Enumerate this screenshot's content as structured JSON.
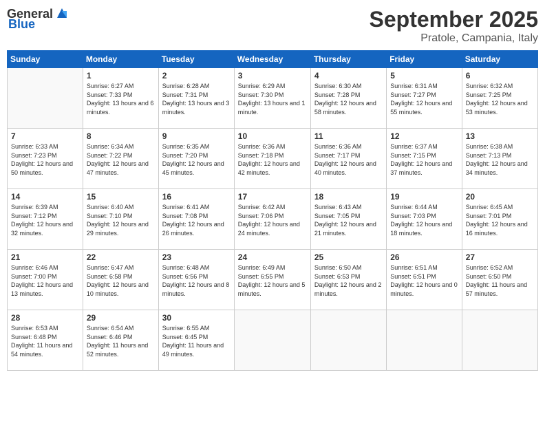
{
  "logo": {
    "text_general": "General",
    "text_blue": "Blue"
  },
  "header": {
    "month": "September 2025",
    "location": "Pratole, Campania, Italy"
  },
  "weekdays": [
    "Sunday",
    "Monday",
    "Tuesday",
    "Wednesday",
    "Thursday",
    "Friday",
    "Saturday"
  ],
  "weeks": [
    [
      {
        "day": "",
        "sunrise": "",
        "sunset": "",
        "daylight": ""
      },
      {
        "day": "1",
        "sunrise": "Sunrise: 6:27 AM",
        "sunset": "Sunset: 7:33 PM",
        "daylight": "Daylight: 13 hours and 6 minutes."
      },
      {
        "day": "2",
        "sunrise": "Sunrise: 6:28 AM",
        "sunset": "Sunset: 7:31 PM",
        "daylight": "Daylight: 13 hours and 3 minutes."
      },
      {
        "day": "3",
        "sunrise": "Sunrise: 6:29 AM",
        "sunset": "Sunset: 7:30 PM",
        "daylight": "Daylight: 13 hours and 1 minute."
      },
      {
        "day": "4",
        "sunrise": "Sunrise: 6:30 AM",
        "sunset": "Sunset: 7:28 PM",
        "daylight": "Daylight: 12 hours and 58 minutes."
      },
      {
        "day": "5",
        "sunrise": "Sunrise: 6:31 AM",
        "sunset": "Sunset: 7:27 PM",
        "daylight": "Daylight: 12 hours and 55 minutes."
      },
      {
        "day": "6",
        "sunrise": "Sunrise: 6:32 AM",
        "sunset": "Sunset: 7:25 PM",
        "daylight": "Daylight: 12 hours and 53 minutes."
      }
    ],
    [
      {
        "day": "7",
        "sunrise": "Sunrise: 6:33 AM",
        "sunset": "Sunset: 7:23 PM",
        "daylight": "Daylight: 12 hours and 50 minutes."
      },
      {
        "day": "8",
        "sunrise": "Sunrise: 6:34 AM",
        "sunset": "Sunset: 7:22 PM",
        "daylight": "Daylight: 12 hours and 47 minutes."
      },
      {
        "day": "9",
        "sunrise": "Sunrise: 6:35 AM",
        "sunset": "Sunset: 7:20 PM",
        "daylight": "Daylight: 12 hours and 45 minutes."
      },
      {
        "day": "10",
        "sunrise": "Sunrise: 6:36 AM",
        "sunset": "Sunset: 7:18 PM",
        "daylight": "Daylight: 12 hours and 42 minutes."
      },
      {
        "day": "11",
        "sunrise": "Sunrise: 6:36 AM",
        "sunset": "Sunset: 7:17 PM",
        "daylight": "Daylight: 12 hours and 40 minutes."
      },
      {
        "day": "12",
        "sunrise": "Sunrise: 6:37 AM",
        "sunset": "Sunset: 7:15 PM",
        "daylight": "Daylight: 12 hours and 37 minutes."
      },
      {
        "day": "13",
        "sunrise": "Sunrise: 6:38 AM",
        "sunset": "Sunset: 7:13 PM",
        "daylight": "Daylight: 12 hours and 34 minutes."
      }
    ],
    [
      {
        "day": "14",
        "sunrise": "Sunrise: 6:39 AM",
        "sunset": "Sunset: 7:12 PM",
        "daylight": "Daylight: 12 hours and 32 minutes."
      },
      {
        "day": "15",
        "sunrise": "Sunrise: 6:40 AM",
        "sunset": "Sunset: 7:10 PM",
        "daylight": "Daylight: 12 hours and 29 minutes."
      },
      {
        "day": "16",
        "sunrise": "Sunrise: 6:41 AM",
        "sunset": "Sunset: 7:08 PM",
        "daylight": "Daylight: 12 hours and 26 minutes."
      },
      {
        "day": "17",
        "sunrise": "Sunrise: 6:42 AM",
        "sunset": "Sunset: 7:06 PM",
        "daylight": "Daylight: 12 hours and 24 minutes."
      },
      {
        "day": "18",
        "sunrise": "Sunrise: 6:43 AM",
        "sunset": "Sunset: 7:05 PM",
        "daylight": "Daylight: 12 hours and 21 minutes."
      },
      {
        "day": "19",
        "sunrise": "Sunrise: 6:44 AM",
        "sunset": "Sunset: 7:03 PM",
        "daylight": "Daylight: 12 hours and 18 minutes."
      },
      {
        "day": "20",
        "sunrise": "Sunrise: 6:45 AM",
        "sunset": "Sunset: 7:01 PM",
        "daylight": "Daylight: 12 hours and 16 minutes."
      }
    ],
    [
      {
        "day": "21",
        "sunrise": "Sunrise: 6:46 AM",
        "sunset": "Sunset: 7:00 PM",
        "daylight": "Daylight: 12 hours and 13 minutes."
      },
      {
        "day": "22",
        "sunrise": "Sunrise: 6:47 AM",
        "sunset": "Sunset: 6:58 PM",
        "daylight": "Daylight: 12 hours and 10 minutes."
      },
      {
        "day": "23",
        "sunrise": "Sunrise: 6:48 AM",
        "sunset": "Sunset: 6:56 PM",
        "daylight": "Daylight: 12 hours and 8 minutes."
      },
      {
        "day": "24",
        "sunrise": "Sunrise: 6:49 AM",
        "sunset": "Sunset: 6:55 PM",
        "daylight": "Daylight: 12 hours and 5 minutes."
      },
      {
        "day": "25",
        "sunrise": "Sunrise: 6:50 AM",
        "sunset": "Sunset: 6:53 PM",
        "daylight": "Daylight: 12 hours and 2 minutes."
      },
      {
        "day": "26",
        "sunrise": "Sunrise: 6:51 AM",
        "sunset": "Sunset: 6:51 PM",
        "daylight": "Daylight: 12 hours and 0 minutes."
      },
      {
        "day": "27",
        "sunrise": "Sunrise: 6:52 AM",
        "sunset": "Sunset: 6:50 PM",
        "daylight": "Daylight: 11 hours and 57 minutes."
      }
    ],
    [
      {
        "day": "28",
        "sunrise": "Sunrise: 6:53 AM",
        "sunset": "Sunset: 6:48 PM",
        "daylight": "Daylight: 11 hours and 54 minutes."
      },
      {
        "day": "29",
        "sunrise": "Sunrise: 6:54 AM",
        "sunset": "Sunset: 6:46 PM",
        "daylight": "Daylight: 11 hours and 52 minutes."
      },
      {
        "day": "30",
        "sunrise": "Sunrise: 6:55 AM",
        "sunset": "Sunset: 6:45 PM",
        "daylight": "Daylight: 11 hours and 49 minutes."
      },
      {
        "day": "",
        "sunrise": "",
        "sunset": "",
        "daylight": ""
      },
      {
        "day": "",
        "sunrise": "",
        "sunset": "",
        "daylight": ""
      },
      {
        "day": "",
        "sunrise": "",
        "sunset": "",
        "daylight": ""
      },
      {
        "day": "",
        "sunrise": "",
        "sunset": "",
        "daylight": ""
      }
    ]
  ]
}
